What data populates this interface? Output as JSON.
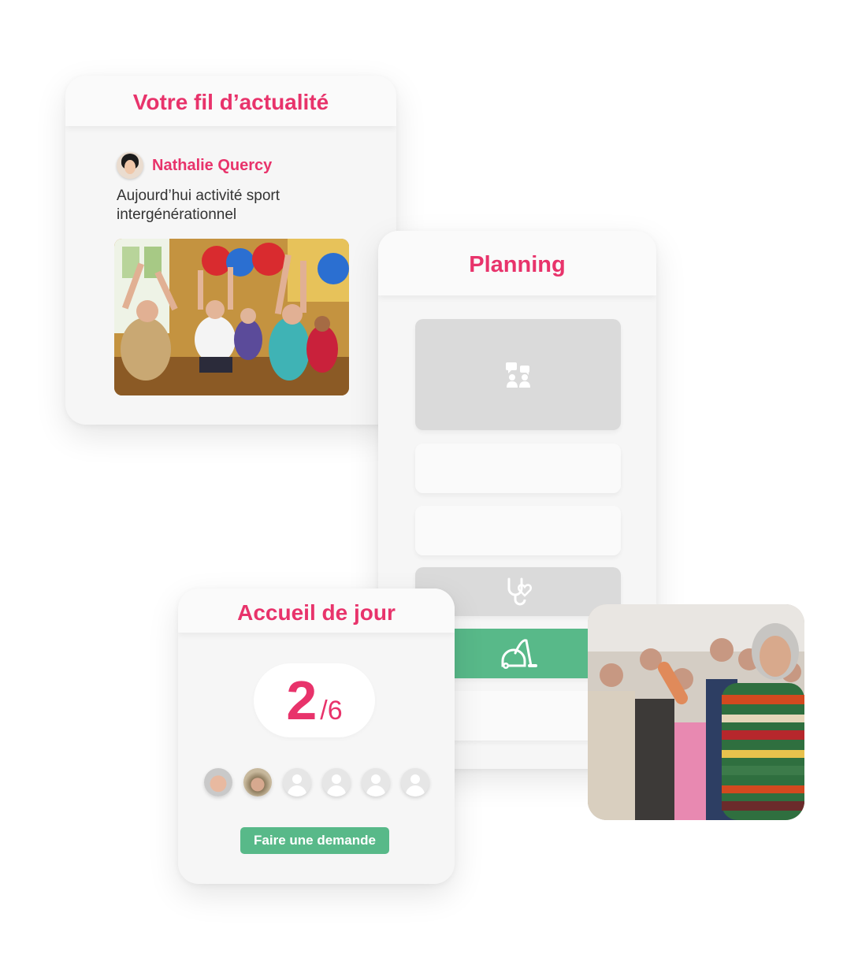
{
  "feed": {
    "title": "Votre fil d’actualité",
    "author": "Nathalie Quercy",
    "post": "Aujourd’hui activité sport intergénérationnel"
  },
  "planning": {
    "title": "Planning",
    "slots": [
      {
        "state": "grey",
        "icon": "meeting-icon"
      },
      {
        "state": "empty"
      },
      {
        "state": "empty"
      },
      {
        "state": "grey",
        "icon": "stethoscope-heart-icon"
      },
      {
        "state": "green",
        "icon": "vacuum-cleaner-icon"
      },
      {
        "state": "empty"
      }
    ],
    "colors": {
      "green": "#58b989",
      "grey": "#dadada",
      "accent": "#e8336b"
    }
  },
  "daycare": {
    "title": "Accueil de jour",
    "count": "2",
    "total": "/6",
    "button": "Faire une demande"
  }
}
